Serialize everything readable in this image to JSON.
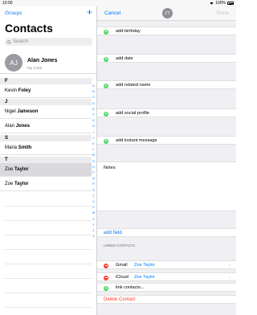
{
  "status": {
    "time": "10:00",
    "battery": "100%"
  },
  "left": {
    "groups_label": "Groups",
    "add_label": "+",
    "title": "Contacts",
    "search_placeholder": "Search",
    "my_card": {
      "initials": "AJ",
      "name": "Alan Jones",
      "subtitle": "My Card"
    },
    "sections": [
      {
        "letter": "F",
        "rows": [
          {
            "first": "Kevin",
            "last": "Foley",
            "selected": false
          }
        ]
      },
      {
        "letter": "J",
        "rows": [
          {
            "first": "Nigel",
            "last": "Jameson",
            "selected": false
          },
          {
            "first": "Alan",
            "last": "Jones",
            "selected": false
          }
        ]
      },
      {
        "letter": "S",
        "rows": [
          {
            "first": "Maria",
            "last": "Smith",
            "selected": false
          }
        ]
      },
      {
        "letter": "T",
        "rows": [
          {
            "first": "Zoe",
            "last": "Taylor",
            "selected": true
          },
          {
            "first": "Zoe",
            "last": "Taylor",
            "selected": false
          }
        ]
      }
    ],
    "index_letters": [
      "A",
      "B",
      "C",
      "D",
      "E",
      "F",
      "G",
      "H",
      "I",
      "J",
      "K",
      "L",
      "M",
      "N",
      "O",
      "P",
      "Q",
      "R",
      "S",
      "T",
      "U",
      "V",
      "W",
      "X",
      "Y",
      "Z",
      "#"
    ]
  },
  "right": {
    "cancel_label": "Cancel",
    "avatar_initials": "ZT",
    "done_label": "Done",
    "add_rows": [
      "add birthday",
      "add date",
      "add related name",
      "add social profile",
      "add instant message"
    ],
    "notes_label": "Notes",
    "add_field_label": "add field",
    "linked_header": "LINKED CONTACTS",
    "linked": [
      {
        "service": "Gmail",
        "name": "Zoe Taylor"
      },
      {
        "service": "iCloud",
        "name": "Zoe Taylor"
      }
    ],
    "link_contacts_label": "link contacts...",
    "delete_label": "Delete Contact",
    "colors": {
      "accent": "#007aff",
      "add": "#4cd964",
      "remove": "#ff3b30"
    }
  }
}
